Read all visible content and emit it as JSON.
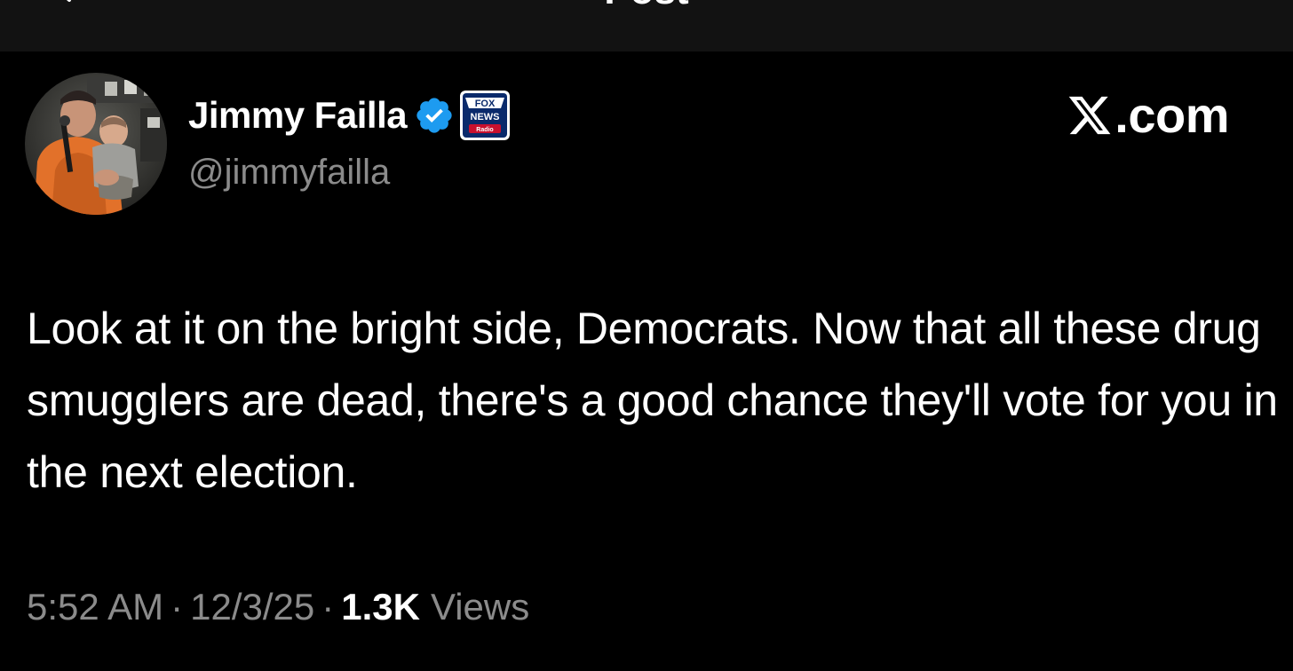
{
  "header": {
    "title": "Post",
    "back_icon": "back-arrow-icon"
  },
  "author": {
    "display_name": "Jimmy Failla",
    "handle": "@jimmyfailla",
    "verified_icon": "verified-check-icon",
    "affiliation_badge_icon": "fox-news-radio-badge-icon",
    "accent_color": "#1d9bf0"
  },
  "watermark": {
    "icon": "x-logo-icon",
    "text": ".com"
  },
  "tweet": {
    "text": "Look at it on the bright side, Democrats. Now that all these drug smugglers are dead, there's a good chance they'll vote for you in the next election."
  },
  "meta": {
    "time": "5:52 AM",
    "separator": "·",
    "date": "12/3/25",
    "views_count": "1.3K",
    "views_label": "Views"
  },
  "colors": {
    "background": "#000000",
    "text_primary": "#ffffff",
    "text_secondary": "#8b8b8b",
    "topbar": "#121212"
  }
}
